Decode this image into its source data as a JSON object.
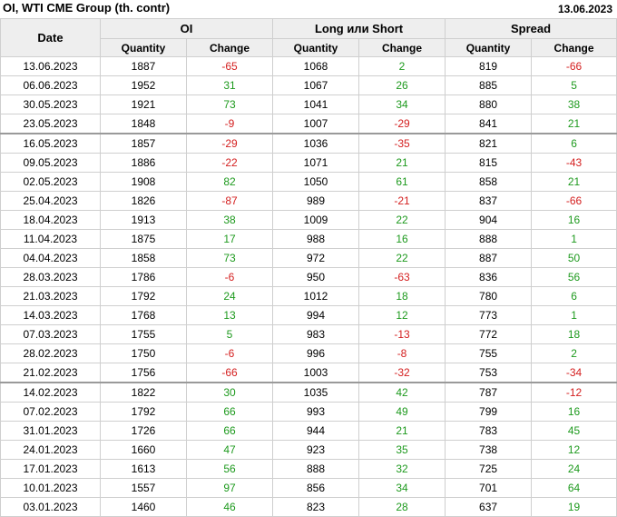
{
  "title": "OI, WTI CME Group (th. contr)",
  "report_date": "13.06.2023",
  "colors": {
    "positive": "#1e9a1e",
    "negative": "#d42020",
    "header_bg": "#eeeeee"
  },
  "headers": {
    "date": "Date",
    "groups": [
      "OI",
      "Long или Short",
      "Spread"
    ],
    "quantity": "Quantity",
    "change": "Change"
  },
  "rows": [
    {
      "date": "13.06.2023",
      "oi_q": "1887",
      "oi_c": "-65",
      "ls_q": "1068",
      "ls_c": "2",
      "sp_q": "819",
      "sp_c": "-66"
    },
    {
      "date": "06.06.2023",
      "oi_q": "1952",
      "oi_c": "31",
      "ls_q": "1067",
      "ls_c": "26",
      "sp_q": "885",
      "sp_c": "5"
    },
    {
      "date": "30.05.2023",
      "oi_q": "1921",
      "oi_c": "73",
      "ls_q": "1041",
      "ls_c": "34",
      "sp_q": "880",
      "sp_c": "38"
    },
    {
      "date": "23.05.2023",
      "oi_q": "1848",
      "oi_c": "-9",
      "ls_q": "1007",
      "ls_c": "-29",
      "sp_q": "841",
      "sp_c": "21"
    },
    {
      "date": "16.05.2023",
      "oi_q": "1857",
      "oi_c": "-29",
      "ls_q": "1036",
      "ls_c": "-35",
      "sp_q": "821",
      "sp_c": "6"
    },
    {
      "date": "09.05.2023",
      "oi_q": "1886",
      "oi_c": "-22",
      "ls_q": "1071",
      "ls_c": "21",
      "sp_q": "815",
      "sp_c": "-43"
    },
    {
      "date": "02.05.2023",
      "oi_q": "1908",
      "oi_c": "82",
      "ls_q": "1050",
      "ls_c": "61",
      "sp_q": "858",
      "sp_c": "21"
    },
    {
      "date": "25.04.2023",
      "oi_q": "1826",
      "oi_c": "-87",
      "ls_q": "989",
      "ls_c": "-21",
      "sp_q": "837",
      "sp_c": "-66"
    },
    {
      "date": "18.04.2023",
      "oi_q": "1913",
      "oi_c": "38",
      "ls_q": "1009",
      "ls_c": "22",
      "sp_q": "904",
      "sp_c": "16"
    },
    {
      "date": "11.04.2023",
      "oi_q": "1875",
      "oi_c": "17",
      "ls_q": "988",
      "ls_c": "16",
      "sp_q": "888",
      "sp_c": "1"
    },
    {
      "date": "04.04.2023",
      "oi_q": "1858",
      "oi_c": "73",
      "ls_q": "972",
      "ls_c": "22",
      "sp_q": "887",
      "sp_c": "50"
    },
    {
      "date": "28.03.2023",
      "oi_q": "1786",
      "oi_c": "-6",
      "ls_q": "950",
      "ls_c": "-63",
      "sp_q": "836",
      "sp_c": "56"
    },
    {
      "date": "21.03.2023",
      "oi_q": "1792",
      "oi_c": "24",
      "ls_q": "1012",
      "ls_c": "18",
      "sp_q": "780",
      "sp_c": "6"
    },
    {
      "date": "14.03.2023",
      "oi_q": "1768",
      "oi_c": "13",
      "ls_q": "994",
      "ls_c": "12",
      "sp_q": "773",
      "sp_c": "1"
    },
    {
      "date": "07.03.2023",
      "oi_q": "1755",
      "oi_c": "5",
      "ls_q": "983",
      "ls_c": "-13",
      "sp_q": "772",
      "sp_c": "18"
    },
    {
      "date": "28.02.2023",
      "oi_q": "1750",
      "oi_c": "-6",
      "ls_q": "996",
      "ls_c": "-8",
      "sp_q": "755",
      "sp_c": "2"
    },
    {
      "date": "21.02.2023",
      "oi_q": "1756",
      "oi_c": "-66",
      "ls_q": "1003",
      "ls_c": "-32",
      "sp_q": "753",
      "sp_c": "-34"
    },
    {
      "date": "14.02.2023",
      "oi_q": "1822",
      "oi_c": "30",
      "ls_q": "1035",
      "ls_c": "42",
      "sp_q": "787",
      "sp_c": "-12"
    },
    {
      "date": "07.02.2023",
      "oi_q": "1792",
      "oi_c": "66",
      "ls_q": "993",
      "ls_c": "49",
      "sp_q": "799",
      "sp_c": "16"
    },
    {
      "date": "31.01.2023",
      "oi_q": "1726",
      "oi_c": "66",
      "ls_q": "944",
      "ls_c": "21",
      "sp_q": "783",
      "sp_c": "45"
    },
    {
      "date": "24.01.2023",
      "oi_q": "1660",
      "oi_c": "47",
      "ls_q": "923",
      "ls_c": "35",
      "sp_q": "738",
      "sp_c": "12"
    },
    {
      "date": "17.01.2023",
      "oi_q": "1613",
      "oi_c": "56",
      "ls_q": "888",
      "ls_c": "32",
      "sp_q": "725",
      "sp_c": "24"
    },
    {
      "date": "10.01.2023",
      "oi_q": "1557",
      "oi_c": "97",
      "ls_q": "856",
      "ls_c": "34",
      "sp_q": "701",
      "sp_c": "64"
    },
    {
      "date": "03.01.2023",
      "oi_q": "1460",
      "oi_c": "46",
      "ls_q": "823",
      "ls_c": "28",
      "sp_q": "637",
      "sp_c": "19"
    }
  ]
}
